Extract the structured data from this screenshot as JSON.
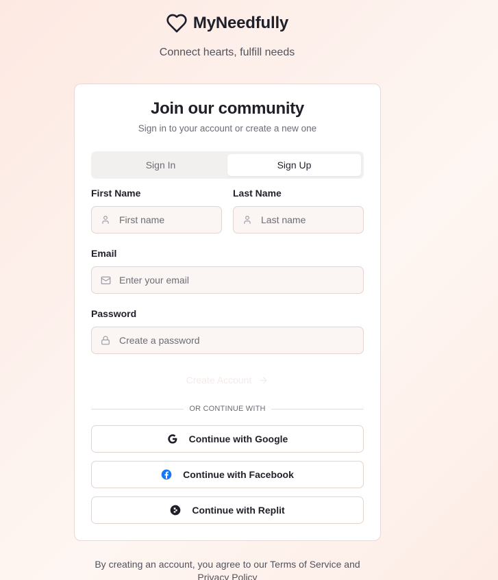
{
  "brand": {
    "name": "MyNeedfully",
    "tagline": "Connect hearts, fulfill needs"
  },
  "card": {
    "title": "Join our community",
    "subtitle": "Sign in to your account or create a new one"
  },
  "tabs": [
    {
      "label": "Sign In",
      "active": false
    },
    {
      "label": "Sign Up",
      "active": true
    }
  ],
  "form": {
    "first_name": {
      "label": "First Name",
      "placeholder": "First name",
      "value": ""
    },
    "last_name": {
      "label": "Last Name",
      "placeholder": "Last name",
      "value": ""
    },
    "email": {
      "label": "Email",
      "placeholder": "Enter your email",
      "value": ""
    },
    "password": {
      "label": "Password",
      "placeholder": "Create a password",
      "value": ""
    },
    "submit_label": "Create Account"
  },
  "divider_text": "OR CONTINUE WITH",
  "social": {
    "google": "Continue with Google",
    "facebook": "Continue with Facebook",
    "replit": "Continue with Replit"
  },
  "footer": {
    "prefix": "By creating an account, you agree to our",
    "terms": "Terms of Service",
    "and": "and",
    "privacy": "Privacy Policy"
  },
  "colors": {
    "background": "#fdf1ec",
    "text": "#1f1f29",
    "muted": "#6b6c75",
    "facebook": "#1877f2"
  }
}
